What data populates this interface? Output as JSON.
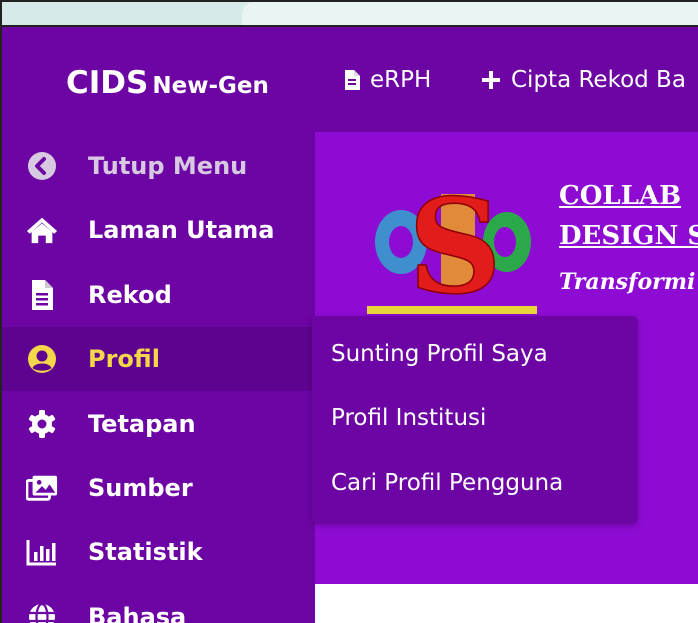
{
  "brand": {
    "name": "CIDS",
    "suffix": "New-Gen"
  },
  "topnav": {
    "erph": {
      "label": "eRPH",
      "icon": "document-icon"
    },
    "cipta": {
      "label": "Cipta Rekod Ba",
      "icon": "plus-icon"
    }
  },
  "sidebar": {
    "items": [
      {
        "label": "Tutup Menu",
        "icon": "chevron-left-circle-icon"
      },
      {
        "label": "Laman Utama",
        "icon": "home-icon"
      },
      {
        "label": "Rekod",
        "icon": "document-icon"
      },
      {
        "label": "Profil",
        "icon": "user-circle-icon"
      },
      {
        "label": "Tetapan",
        "icon": "gear-icon"
      },
      {
        "label": "Sumber",
        "icon": "images-icon"
      },
      {
        "label": "Statistik",
        "icon": "bar-chart-icon"
      },
      {
        "label": "Bahasa",
        "icon": "globe-icon"
      }
    ]
  },
  "submenu": {
    "items": [
      {
        "label": "Sunting Profil Saya"
      },
      {
        "label": "Profil Institusi"
      },
      {
        "label": "Cari Profil Pengguna"
      }
    ]
  },
  "main": {
    "heading_line1": "COLLAB",
    "heading_line2": "DESIGN S",
    "tagline": "Transformi"
  },
  "colors": {
    "navbar": "#6c05a3",
    "content": "#8d0bd2",
    "active_text": "#f4d64a",
    "active_bg": "#5e0290"
  }
}
